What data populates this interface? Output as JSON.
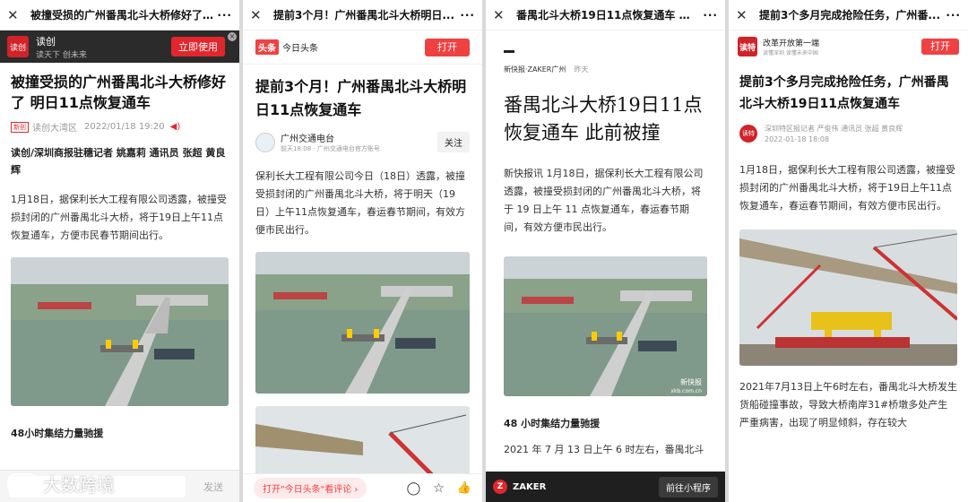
{
  "panel1": {
    "title_bar": "被撞受损的广州番禺北斗大桥修好了...",
    "app_banner": {
      "logo": "读创",
      "name": "读创",
      "slogan": "读天下 创未来",
      "button": "立即使用"
    },
    "headline": "被撞受损的广州番禺北斗大桥修好了 明日11点恢复通车",
    "source_badge": "新创",
    "source": "读创大湾区",
    "date": "2022/01/18 19:20",
    "byline": "读创/深圳商报驻穗记者 姚嘉莉 通讯员 张超 黄良辉",
    "para1": "1月18日，据保利长大工程有限公司透露，被撞受损封闭的广州番禺北斗大桥，将于19日上午11点恢复通车，方便市民春节期间出行。",
    "subhead": "48小时集结力量驰援",
    "comment_btn": "发送"
  },
  "panel2": {
    "title_bar": "提前3个月！广州番禺北斗大桥明日...",
    "app_logo": "头条",
    "app_name": "今日头条",
    "open_button": "打开",
    "headline": "提前3个月！广州番禺北斗大桥明日11点恢复通车",
    "account": "广州交通电台",
    "account_meta": "前天18:08 · 广州交通电台官方账号",
    "follow": "关注",
    "para1": "保利长大工程有限公司今日（18日）透露，被撞受损封闭的广州番禺北斗大桥，将于明天（19日）上午11点恢复通车，春运春节期间，有效方便市民出行。",
    "bottom_cta": "打开\"今日头条\"看评论 ›"
  },
  "panel3": {
    "title_bar": "番禺北斗大桥19日11点恢复通车 此...",
    "source": "新快报·ZAKER广州",
    "time": "昨天",
    "headline": "番禺北斗大桥19日11点恢复通车 此前被撞",
    "para1": "新快报讯 1月18日，据保利长大工程有限公司透露，被撞受损封闭的广州番禺北斗大桥，将于 19 日上午 11 点恢复通车，春运春节期间，有效方便市民出行。",
    "watermark": "新快报",
    "watermark_url": "xkb.com.cn",
    "subhead": "48 小时集结力量驰援",
    "para2": "2021 年 7 月 13 日上午 6 时左右，番禺北斗",
    "zaker_label": "ZAKER",
    "mini_program": "前往小程序"
  },
  "panel4": {
    "title_bar": "提前3个多月完成抢险任务，广州番...",
    "app_logo": "读特",
    "app_name": "改革开放第一端",
    "app_slogan": "读懂深圳 读懂未来中国",
    "open_button": "打开",
    "headline": "提前3个多月完成抢险任务，广州番禺北斗大桥19日11点恢复通车",
    "avatar": "读特",
    "reporters": "深圳特区报记者 严俊伟 通讯员 张超 黄良辉",
    "date": "2022-01-18 18:08",
    "para1": "1月18日，据保利长大工程有限公司透露，被撞受损封闭的广州番禺北斗大桥，将于19日上午11点恢复通车，春运春节期间，有效方便市民出行。",
    "para2": "2021年7月13日上午6时左右，番禺北斗大桥发生货船碰撞事故，导致大桥南岸31#桥墩多处产生严重病害，出现了明显倾斜，存在较大"
  },
  "watermark": "大数跨境",
  "colors": {
    "red": "#f04142",
    "banner_dark": "#2b2b2b"
  }
}
